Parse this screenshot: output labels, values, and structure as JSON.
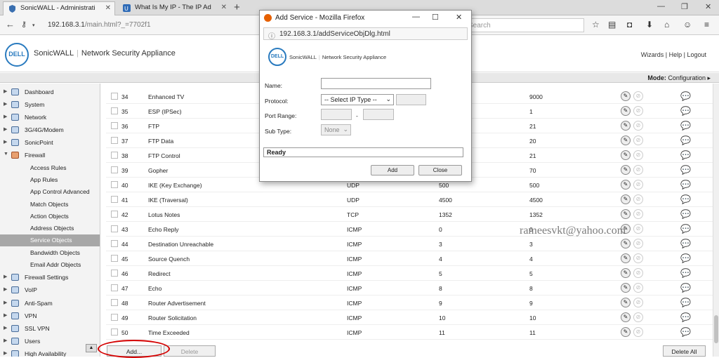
{
  "browser": {
    "tabs": [
      {
        "title": "SonicWALL - Administrati"
      },
      {
        "title": "What Is My IP - The IP Ad"
      }
    ],
    "url_main": "192.168.3.1",
    "url_rest": "/main.html?_=7702f1",
    "search_placeholder": "Search"
  },
  "header": {
    "logo": "DELL",
    "brand": "SonicWALL",
    "product": "Network Security Appliance",
    "links": {
      "wizards": "Wizards",
      "help": "Help",
      "logout": "Logout"
    }
  },
  "modebar": {
    "label": "Mode:",
    "value": "Configuration"
  },
  "sidebar": {
    "items": [
      {
        "label": "Dashboard"
      },
      {
        "label": "System"
      },
      {
        "label": "Network"
      },
      {
        "label": "3G/4G/Modem"
      },
      {
        "label": "SonicPoint"
      },
      {
        "label": "Firewall"
      },
      {
        "label": "Access Rules"
      },
      {
        "label": "App Rules"
      },
      {
        "label": "App Control Advanced"
      },
      {
        "label": "Match Objects"
      },
      {
        "label": "Action Objects"
      },
      {
        "label": "Address Objects"
      },
      {
        "label": "Service Objects"
      },
      {
        "label": "Bandwidth Objects"
      },
      {
        "label": "Email Addr Objects"
      },
      {
        "label": "Firewall Settings"
      },
      {
        "label": "VoIP"
      },
      {
        "label": "Anti-Spam"
      },
      {
        "label": "VPN"
      },
      {
        "label": "SSL VPN"
      },
      {
        "label": "Users"
      },
      {
        "label": "High Availability"
      }
    ]
  },
  "table": {
    "rows": [
      {
        "num": "34",
        "name": "Enhanced TV",
        "proto": "",
        "start": "",
        "end": "9000"
      },
      {
        "num": "35",
        "name": "ESP (IPSec)",
        "proto": "",
        "start": "",
        "end": "1"
      },
      {
        "num": "36",
        "name": "FTP",
        "proto": "",
        "start": "",
        "end": "21"
      },
      {
        "num": "37",
        "name": "FTP Data",
        "proto": "",
        "start": "",
        "end": "20"
      },
      {
        "num": "38",
        "name": "FTP Control",
        "proto": "",
        "start": "",
        "end": "21"
      },
      {
        "num": "39",
        "name": "Gopher",
        "proto": "",
        "start": "",
        "end": "70"
      },
      {
        "num": "40",
        "name": "IKE (Key Exchange)",
        "proto": "UDP",
        "start": "500",
        "end": "500"
      },
      {
        "num": "41",
        "name": "IKE (Traversal)",
        "proto": "UDP",
        "start": "4500",
        "end": "4500"
      },
      {
        "num": "42",
        "name": "Lotus Notes",
        "proto": "TCP",
        "start": "1352",
        "end": "1352"
      },
      {
        "num": "43",
        "name": "Echo Reply",
        "proto": "ICMP",
        "start": "0",
        "end": "0"
      },
      {
        "num": "44",
        "name": "Destination Unreachable",
        "proto": "ICMP",
        "start": "3",
        "end": "3"
      },
      {
        "num": "45",
        "name": "Source Quench",
        "proto": "ICMP",
        "start": "4",
        "end": "4"
      },
      {
        "num": "46",
        "name": "Redirect",
        "proto": "ICMP",
        "start": "5",
        "end": "5"
      },
      {
        "num": "47",
        "name": "Echo",
        "proto": "ICMP",
        "start": "8",
        "end": "8"
      },
      {
        "num": "48",
        "name": "Router Advertisement",
        "proto": "ICMP",
        "start": "9",
        "end": "9"
      },
      {
        "num": "49",
        "name": "Router Solicitation",
        "proto": "ICMP",
        "start": "10",
        "end": "10"
      },
      {
        "num": "50",
        "name": "Time Exceeded",
        "proto": "ICMP",
        "start": "11",
        "end": "11"
      }
    ],
    "add_label": "Add...",
    "delete_label": "Delete",
    "delete_all_label": "Delete All"
  },
  "watermark": "rameesvkt@yahoo.com",
  "popup": {
    "title": "Add Service - Mozilla Firefox",
    "url": "192.168.3.1/addServiceObjDlg.html",
    "logo": "DELL",
    "brand": "SonicWALL",
    "product": "Network Security Appliance",
    "name_label": "Name:",
    "protocol_label": "Protocol:",
    "protocol_value": "-- Select IP Type --",
    "port_range_label": "Port Range:",
    "port_sep": "-",
    "subtype_label": "Sub Type:",
    "subtype_value": "None",
    "status": "Ready",
    "add_label": "Add",
    "close_label": "Close"
  }
}
